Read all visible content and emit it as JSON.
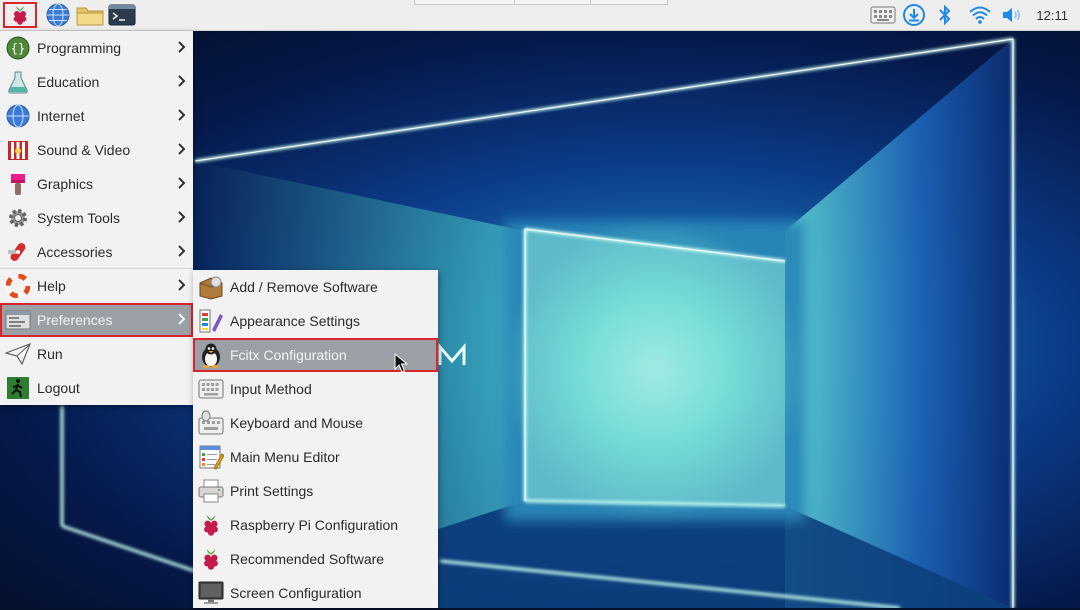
{
  "taskbar": {
    "launchers": [
      {
        "name": "raspberry-menu",
        "icon": "raspberry-icon"
      },
      {
        "name": "web-browser",
        "icon": "globe-icon"
      },
      {
        "name": "file-manager",
        "icon": "folder-icon"
      },
      {
        "name": "terminal",
        "icon": "terminal-icon"
      }
    ],
    "tray_icons": [
      "keyboard-icon",
      "download-icon",
      "bluetooth-icon",
      "wifi-icon",
      "volume-icon"
    ],
    "clock": "12:11"
  },
  "main_menu": {
    "items": [
      {
        "label": "Programming",
        "icon": "programming-icon",
        "submenu": true
      },
      {
        "label": "Education",
        "icon": "education-icon",
        "submenu": true
      },
      {
        "label": "Internet",
        "icon": "internet-icon",
        "submenu": true
      },
      {
        "label": "Sound & Video",
        "icon": "sound-video-icon",
        "submenu": true
      },
      {
        "label": "Graphics",
        "icon": "graphics-icon",
        "submenu": true
      },
      {
        "label": "System Tools",
        "icon": "system-tools-icon",
        "submenu": true
      },
      {
        "label": "Accessories",
        "icon": "accessories-icon",
        "submenu": true
      },
      {
        "label": "Help",
        "icon": "help-icon",
        "submenu": true
      },
      {
        "label": "Preferences",
        "icon": "preferences-icon",
        "submenu": true,
        "active": true
      },
      {
        "label": "Run",
        "icon": "run-icon",
        "submenu": false
      },
      {
        "label": "Logout",
        "icon": "logout-icon",
        "submenu": false
      }
    ]
  },
  "preferences_menu": {
    "items": [
      {
        "label": "Add / Remove Software",
        "icon": "package-icon"
      },
      {
        "label": "Appearance Settings",
        "icon": "appearance-icon"
      },
      {
        "label": "Fcitx Configuration",
        "icon": "penguin-icon",
        "active": true
      },
      {
        "label": "Input Method",
        "icon": "keyboard-icon"
      },
      {
        "label": "Keyboard and Mouse",
        "icon": "keyboard-mouse-icon"
      },
      {
        "label": "Main Menu Editor",
        "icon": "menu-editor-icon"
      },
      {
        "label": "Print Settings",
        "icon": "printer-icon"
      },
      {
        "label": "Raspberry Pi Configuration",
        "icon": "raspberry-icon"
      },
      {
        "label": "Recommended Software",
        "icon": "raspberry-icon"
      },
      {
        "label": "Screen Configuration",
        "icon": "monitor-icon"
      }
    ]
  },
  "colors": {
    "highlight_border": "#d7262d",
    "active_item_bg": "#9aa0a6",
    "menu_bg": "#f2f2f2",
    "taskbar_bg": "#eeeeee"
  }
}
